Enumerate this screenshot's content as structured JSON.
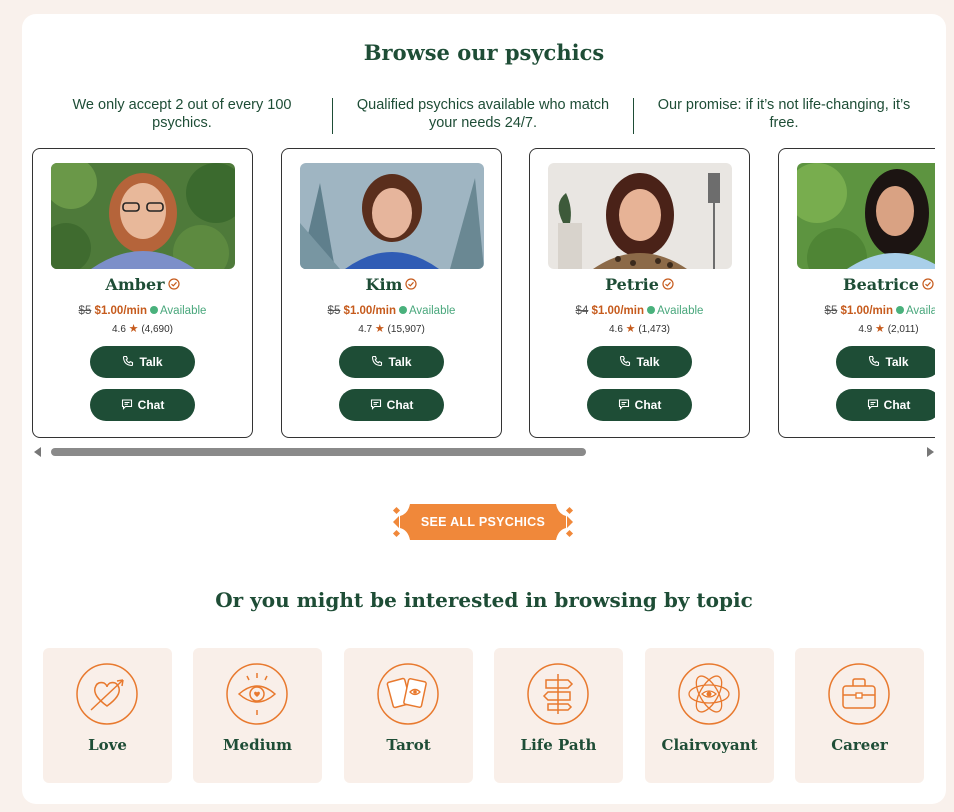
{
  "section": {
    "title": "Browse our psychics",
    "features": [
      "We only accept 2 out of every 100 psychics.",
      "Qualified psychics available who match your needs 24/7.",
      "Our promise: if it’s not life-changing, it’s free."
    ]
  },
  "psychics": [
    {
      "name": "Amber",
      "old_price": "$5",
      "price": "$1.00/min",
      "status": "Available",
      "rating": "4.6",
      "reviews": "(4,690)",
      "talk_label": "Talk",
      "chat_label": "Chat"
    },
    {
      "name": "Kim",
      "old_price": "$5",
      "price": "$1.00/min",
      "status": "Available",
      "rating": "4.7",
      "reviews": "(15,907)",
      "talk_label": "Talk",
      "chat_label": "Chat"
    },
    {
      "name": "Petrie",
      "old_price": "$4",
      "price": "$1.00/min",
      "status": "Available",
      "rating": "4.6",
      "reviews": "(1,473)",
      "talk_label": "Talk",
      "chat_label": "Chat"
    },
    {
      "name": "Beatrice",
      "old_price": "$5",
      "price": "$1.00/min",
      "status": "Available",
      "rating": "4.9",
      "reviews": "(2,011)",
      "talk_label": "Talk",
      "chat_label": "Chat"
    }
  ],
  "see_all_label": "SEE ALL PSYCHICS",
  "topics": {
    "title": "Or you might be interested in browsing by topic",
    "items": [
      {
        "label": "Love",
        "icon": "heart-arrow-icon"
      },
      {
        "label": "Medium",
        "icon": "eye-icon"
      },
      {
        "label": "Tarot",
        "icon": "tarot-cards-icon"
      },
      {
        "label": "Life Path",
        "icon": "signpost-icon"
      },
      {
        "label": "Clairvoyant",
        "icon": "orbit-eye-icon"
      },
      {
        "label": "Career",
        "icon": "briefcase-icon"
      }
    ]
  },
  "colors": {
    "brand_green": "#1e4d36",
    "accent_orange": "#f0883a",
    "price_orange": "#c65b1d",
    "available_green": "#49b17c",
    "topic_bg": "#f9efe9",
    "page_bg": "#f9f1ec"
  }
}
